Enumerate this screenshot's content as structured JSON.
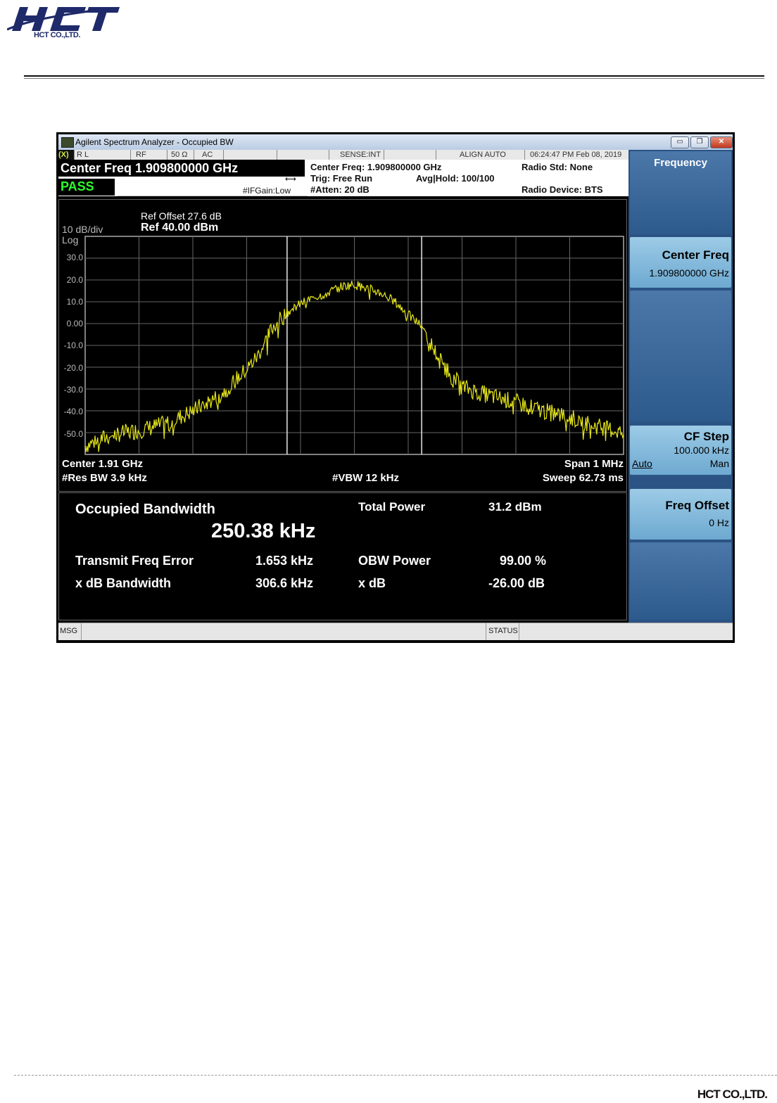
{
  "page": {
    "logo_text": "HCT",
    "logo_subtext": "HCT CO.,LTD.",
    "footer_company": "HCT CO.,LTD."
  },
  "window": {
    "title": "Agilent Spectrum Analyzer - Occupied BW",
    "controls": [
      "▭",
      "❐",
      "✕"
    ]
  },
  "status_strip": {
    "logo": "(X)",
    "rl": "R L",
    "rf": "RF",
    "impedance": "50 Ω",
    "coupling": "AC",
    "sense": "SENSE:INT",
    "align": "ALIGN AUTO",
    "datetime": "06:24:47 PM Feb 08, 2019"
  },
  "info": {
    "center_freq_title": "Center Freq 1.909800000 GHz",
    "pass_label": "PASS",
    "ifgain": "#IFGain:Low",
    "center_freq": "Center Freq: 1.909800000 GHz",
    "trig": "Trig: Free Run",
    "avg_hold": "Avg|Hold: 100/100",
    "atten": "#Atten: 20 dB",
    "radio_std": "Radio Std: None",
    "radio_device": "Radio Device: BTS"
  },
  "graph": {
    "ref_offset": "Ref Offset 27.6 dB",
    "ref_level": "Ref 40.00 dBm",
    "scale": "10 dB/div",
    "scale_type": "Log",
    "y_ticks": [
      "30.0",
      "20.0",
      "10.0",
      "0.00",
      "-10.0",
      "-20.0",
      "-30.0",
      "-40.0",
      "-50.0"
    ],
    "center": "Center  1.91 GHz",
    "res_bw": "#Res BW  3.9 kHz",
    "vbw": "#VBW  12 kHz",
    "span": "Span 1 MHz",
    "sweep": "Sweep  62.73 ms"
  },
  "chart_data": {
    "type": "line",
    "x_label": "",
    "y_unit": "dBm",
    "ylim": [
      -60,
      40
    ],
    "xlim_mhz": [
      -0.5,
      0.5
    ],
    "grid": true,
    "trace_color": "#e6e61a",
    "series": [
      {
        "x": [
          -0.5,
          -0.45,
          -0.4,
          -0.35,
          -0.3,
          -0.25,
          -0.2,
          -0.18,
          -0.15,
          -0.125,
          -0.1,
          -0.075,
          -0.05,
          -0.025,
          0.0,
          0.025,
          0.05,
          0.075,
          0.1,
          0.125,
          0.15,
          0.18,
          0.2,
          0.25,
          0.3,
          0.35,
          0.4,
          0.45,
          0.5
        ],
        "y": [
          -56,
          -51,
          -49,
          -46,
          -40,
          -33,
          -21,
          -15,
          -1,
          5,
          9,
          12,
          14,
          17,
          18,
          16,
          14,
          10,
          4,
          -1,
          -13,
          -24,
          -29,
          -33,
          -36,
          -40,
          -43,
          -47,
          -50
        ]
      }
    ],
    "obw_markers_mhz": [
      -0.125,
      0.125
    ]
  },
  "results": {
    "occupied_bw_label": "Occupied Bandwidth",
    "occupied_bw_value": "250.38 kHz",
    "total_power_label": "Total Power",
    "total_power_value": "31.2 dBm",
    "freq_error_label": "Transmit Freq Error",
    "freq_error_value": "1.653 kHz",
    "obw_power_label": "OBW Power",
    "obw_power_value": "99.00 %",
    "xdb_bw_label": "x dB Bandwidth",
    "xdb_bw_value": "306.6 kHz",
    "xdb_label": "x dB",
    "xdb_value": "-26.00 dB"
  },
  "softkeys": {
    "menu_title": "Frequency",
    "center_freq_label": "Center Freq",
    "center_freq_value": "1.909800000 GHz",
    "cf_step_label": "CF Step",
    "cf_step_value": "100.000 kHz",
    "cf_step_auto": "Auto",
    "cf_step_man": "Man",
    "freq_offset_label": "Freq Offset",
    "freq_offset_value": "0 Hz"
  },
  "bottombar": {
    "msg": "MSG",
    "status": "STATUS"
  }
}
